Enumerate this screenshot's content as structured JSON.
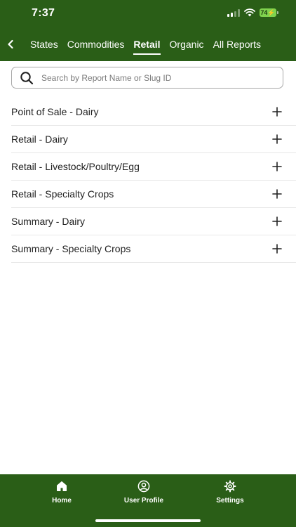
{
  "status_bar": {
    "time": "7:37",
    "battery": "74"
  },
  "tabs": [
    {
      "label": "States",
      "active": false
    },
    {
      "label": "Commodities",
      "active": false
    },
    {
      "label": "Retail",
      "active": true
    },
    {
      "label": "Organic",
      "active": false
    },
    {
      "label": "All Reports",
      "active": false
    }
  ],
  "search": {
    "placeholder": "Search by Report Name or Slug ID",
    "value": ""
  },
  "reports": [
    {
      "label": "Point of Sale - Dairy",
      "icon": "plus-icon"
    },
    {
      "label": "Retail - Dairy",
      "icon": "plus-icon"
    },
    {
      "label": "Retail - Livestock/Poultry/Egg",
      "icon": "plus-icon"
    },
    {
      "label": "Retail - Specialty Crops",
      "icon": "plus-icon"
    },
    {
      "label": "Summary - Dairy",
      "icon": "plus-icon"
    },
    {
      "label": "Summary - Specialty Crops",
      "icon": "plus-icon"
    }
  ],
  "bottom_nav": [
    {
      "label": "Home",
      "icon": "home-icon"
    },
    {
      "label": "User Profile",
      "icon": "user-profile-icon"
    },
    {
      "label": "Settings",
      "icon": "gear-icon"
    }
  ],
  "colors": {
    "brand_green": "#2a5e17",
    "battery_green": "#7fd34e"
  }
}
